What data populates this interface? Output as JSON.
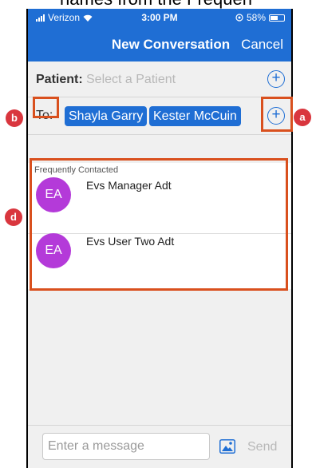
{
  "caption": "names from the Frequen",
  "status_bar": {
    "carrier": "Verizon",
    "time": "3:00 PM",
    "battery": "58%",
    "battery_level": 0.58
  },
  "nav": {
    "title": "New Conversation",
    "cancel_label": "Cancel"
  },
  "patient": {
    "label": "Patient:",
    "placeholder": "Select a Patient",
    "add_icon": "circle-plus-icon"
  },
  "to": {
    "label": "To:",
    "recipients": [
      "Shayla Garry",
      "Kester McCuin"
    ],
    "add_icon": "circle-plus-icon"
  },
  "frequently_contacted": {
    "header": "Frequently Contacted",
    "contacts": [
      {
        "initials": "EA",
        "name": "Evs Manager Adt"
      },
      {
        "initials": "EA",
        "name": "Evs User Two Adt"
      }
    ],
    "avatar_color": "#b43ad9"
  },
  "compose": {
    "placeholder": "Enter a message",
    "image_icon": "image-icon",
    "send_label": "Send"
  },
  "annotations": {
    "a": "a",
    "b": "b",
    "d": "d",
    "color": "#d9501e"
  },
  "colors": {
    "accent": "#1f6ed4",
    "marker": "#d9363e"
  }
}
